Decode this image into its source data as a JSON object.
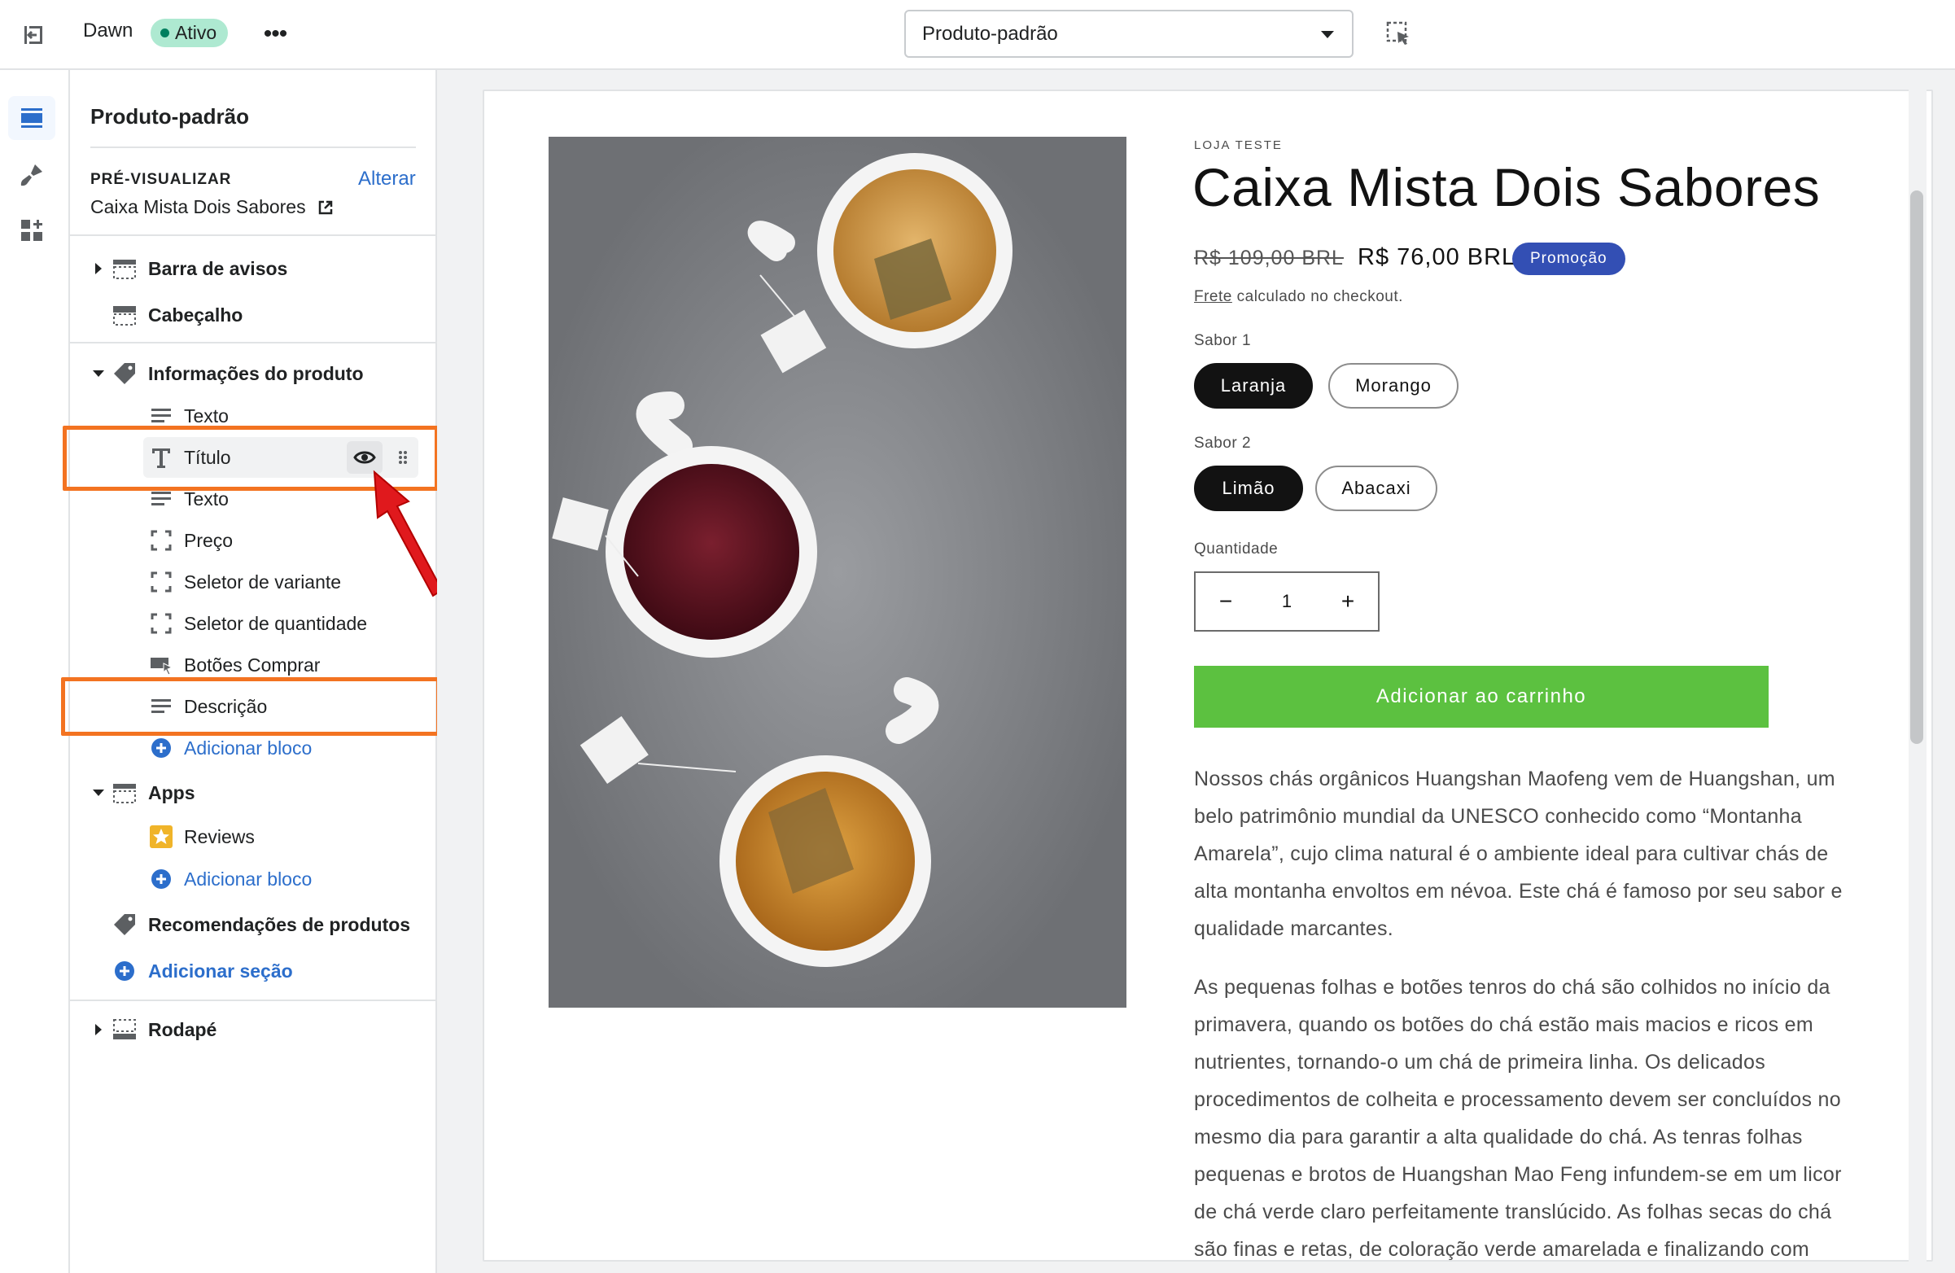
{
  "topbar": {
    "theme_name": "Dawn",
    "status_badge": "Ativo",
    "more_label": "•••",
    "template_select_value": "Produto-padrão"
  },
  "sidebar": {
    "title": "Produto-padrão",
    "preview_label": "PRÉ-VISUALIZAR",
    "preview_change": "Alterar",
    "preview_product": "Caixa Mista Dois Sabores",
    "sections": {
      "announcement_bar": "Barra de avisos",
      "header": "Cabeçalho",
      "product_info": "Informações do produto",
      "blocks": {
        "text1": "Texto",
        "title": "Título",
        "text2": "Texto",
        "price": "Preço",
        "variant_picker": "Seletor de variante",
        "quantity_selector": "Seletor de quantidade",
        "buy_buttons": "Botões Comprar",
        "description": "Descrição",
        "add_block": "Adicionar bloco"
      },
      "apps": "Apps",
      "apps_blocks": {
        "reviews": "Reviews",
        "add_block": "Adicionar bloco"
      },
      "recommendations": "Recomendações de produtos",
      "add_section": "Adicionar seção",
      "footer": "Rodapé"
    }
  },
  "product": {
    "vendor": "LOJA TESTE",
    "title": "Caixa Mista Dois Sabores",
    "price_old": "R$ 109,00 BRL",
    "price_new": "R$ 76,00 BRL",
    "sale_badge": "Promoção",
    "shipping_link": "Frete",
    "shipping_text": " calculado no checkout.",
    "option1": {
      "label": "Sabor 1",
      "values": [
        "Laranja",
        "Morango"
      ],
      "selected": "Laranja"
    },
    "option2": {
      "label": "Sabor 2",
      "values": [
        "Limão",
        "Abacaxi"
      ],
      "selected": "Limão"
    },
    "quantity_label": "Quantidade",
    "quantity_value": "1",
    "quantity_minus": "−",
    "quantity_plus": "+",
    "add_to_cart": "Adicionar ao carrinho",
    "description_p1": "Nossos chás orgânicos Huangshan Maofeng vem de Huangshan, um belo patrimônio mundial da UNESCO conhecido como “Montanha Amarela”, cujo clima natural é o ambiente ideal para cultivar chás de alta montanha envoltos em névoa. Este chá é famoso por seu sabor e qualidade marcantes.",
    "description_p2": "As pequenas folhas e botões tenros do chá são colhidos no início da primavera, quando os botões do chá estão mais macios e ricos em nutrientes, tornando-o um chá de primeira linha. Os delicados procedimentos de colheita e processamento devem ser concluídos no mesmo dia para garantir a alta qualidade do chá. As tenras folhas pequenas e brotos de Huangshan Mao Feng infundem-se em um licor de chá verde claro perfeitamente translúcido. As folhas secas do chá são finas e retas, de coloração verde amarelada e finalizando com"
  },
  "colors": {
    "accent_link": "#2c6ecb",
    "highlight_orange": "#f37321",
    "arrow_red": "#e0191d",
    "add_to_cart_green": "#5cc140",
    "sale_badge_blue": "#334fb4",
    "active_badge_green": "#aee9d1"
  },
  "icons": {
    "exit": "exit-icon",
    "inspector": "select-cursor-icon",
    "sections_rail": "sections-icon",
    "theme_settings_rail": "paintbrush-icon",
    "apps_rail": "apps-icon",
    "external_link": "external-link-icon",
    "tag": "tag-icon",
    "text_lines": "text-lines-icon",
    "title_T": "title-t-icon",
    "dashed_square": "dashed-square-icon",
    "buy_button": "buy-button-icon",
    "plus_circle": "plus-circle-icon",
    "star": "star-icon",
    "eye": "eye-icon",
    "drag": "drag-handle-icon"
  }
}
